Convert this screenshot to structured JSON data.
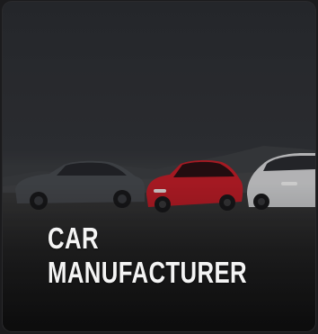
{
  "card": {
    "title_line1": "CAR",
    "title_line2": "MANUFACTURER",
    "image_alt": "Three electric cars parked in a row: dark grey, red and white"
  },
  "colors": {
    "car_left": "#4a4d52",
    "car_middle": "#c81f2a",
    "car_right": "#d9dadc",
    "title_text": "#f4f4f4"
  }
}
